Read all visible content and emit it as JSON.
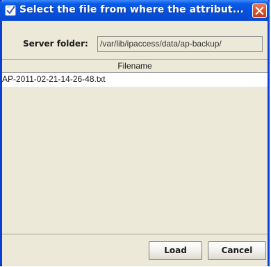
{
  "window": {
    "title": "Select the file from where the attribut...",
    "close_icon": "close-icon",
    "app_icon": "app-icon"
  },
  "folder": {
    "label": "Server folder:",
    "value": "/var/lib/ipaccess/data/ap-backup/"
  },
  "table": {
    "columns": [
      "Filename"
    ],
    "rows": [
      "AP-2011-02-21-14-26-48.txt"
    ]
  },
  "buttons": {
    "load_label": "Load",
    "cancel_label": "Cancel"
  },
  "colors": {
    "titlebar": "#0550df",
    "window_border": "#0a3fd1",
    "close_button": "#d8512a",
    "dialog_bg": "#ece9d8"
  }
}
